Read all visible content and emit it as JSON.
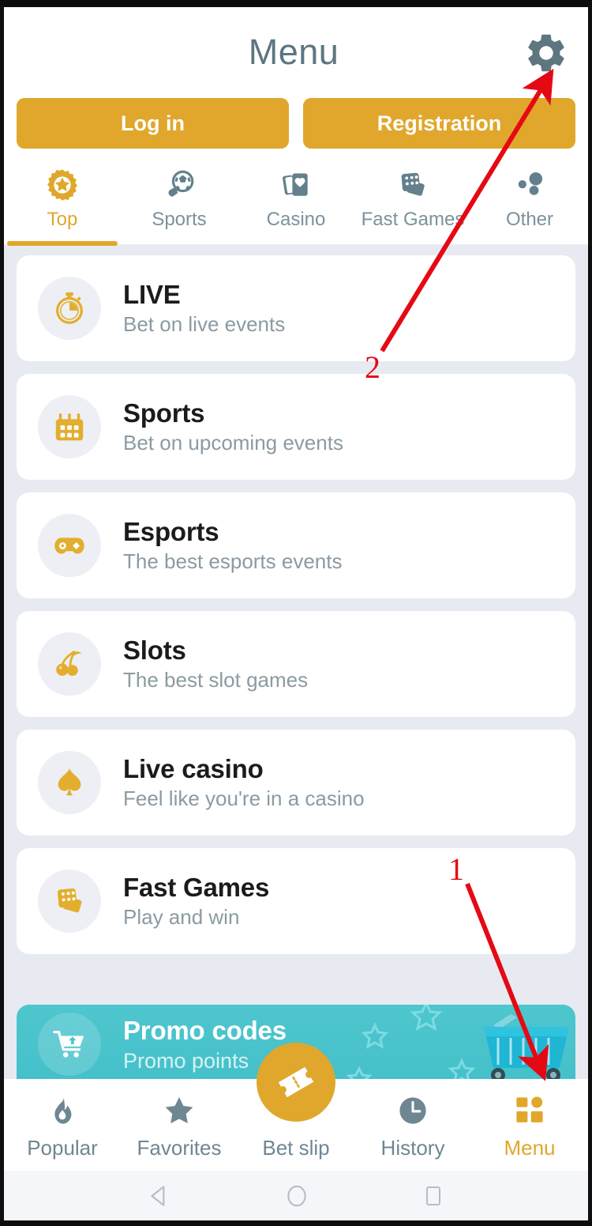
{
  "header": {
    "title": "Menu",
    "settings_icon": "gear-icon"
  },
  "auth": {
    "login_label": "Log in",
    "registration_label": "Registration"
  },
  "tabs": [
    {
      "label": "Top",
      "icon": "star-burst-icon",
      "active": true
    },
    {
      "label": "Sports",
      "icon": "soccer-ball-pin-icon",
      "active": false
    },
    {
      "label": "Casino",
      "icon": "playing-cards-icon",
      "active": false
    },
    {
      "label": "Fast Games",
      "icon": "dice-cards-icon",
      "active": false
    },
    {
      "label": "Other",
      "icon": "dots-cluster-icon",
      "active": false
    }
  ],
  "menu_items": [
    {
      "title": "LIVE",
      "subtitle": "Bet on live events",
      "icon": "stopwatch-icon"
    },
    {
      "title": "Sports",
      "subtitle": "Bet on upcoming events",
      "icon": "calendar-icon"
    },
    {
      "title": "Esports",
      "subtitle": "The best esports events",
      "icon": "gamepad-icon"
    },
    {
      "title": "Slots",
      "subtitle": "The best slot games",
      "icon": "cherries-icon"
    },
    {
      "title": "Live casino",
      "subtitle": "Feel like you're in a casino",
      "icon": "spade-icon"
    },
    {
      "title": "Fast Games",
      "subtitle": "Play and win",
      "icon": "dice-cards-icon"
    }
  ],
  "promo": {
    "title": "Promo codes",
    "subtitle": "Promo points",
    "icon": "shopping-cart-icon",
    "art": "shopping-basket-art"
  },
  "bottom_nav": [
    {
      "label": "Popular",
      "icon": "flame-icon",
      "active": false
    },
    {
      "label": "Favorites",
      "icon": "star-icon",
      "active": false
    },
    {
      "label": "Bet slip",
      "icon": "ticket-icon",
      "active": false
    },
    {
      "label": "History",
      "icon": "clock-icon",
      "active": false
    },
    {
      "label": "Menu",
      "icon": "grid-menu-icon",
      "active": true
    }
  ],
  "system_bar": {
    "back": "triangle-back-icon",
    "home": "circle-home-icon",
    "recents": "square-recents-icon"
  },
  "annotations": [
    {
      "label": "1",
      "points_to": "menu-nav-item"
    },
    {
      "label": "2",
      "points_to": "settings-gear-button"
    }
  ],
  "colors": {
    "accent": "#e0a72c",
    "teal": "#4ec6ce",
    "list_bg": "#e7eaf1",
    "text_muted": "#8b9aa3",
    "annotation_red": "#e50914"
  }
}
